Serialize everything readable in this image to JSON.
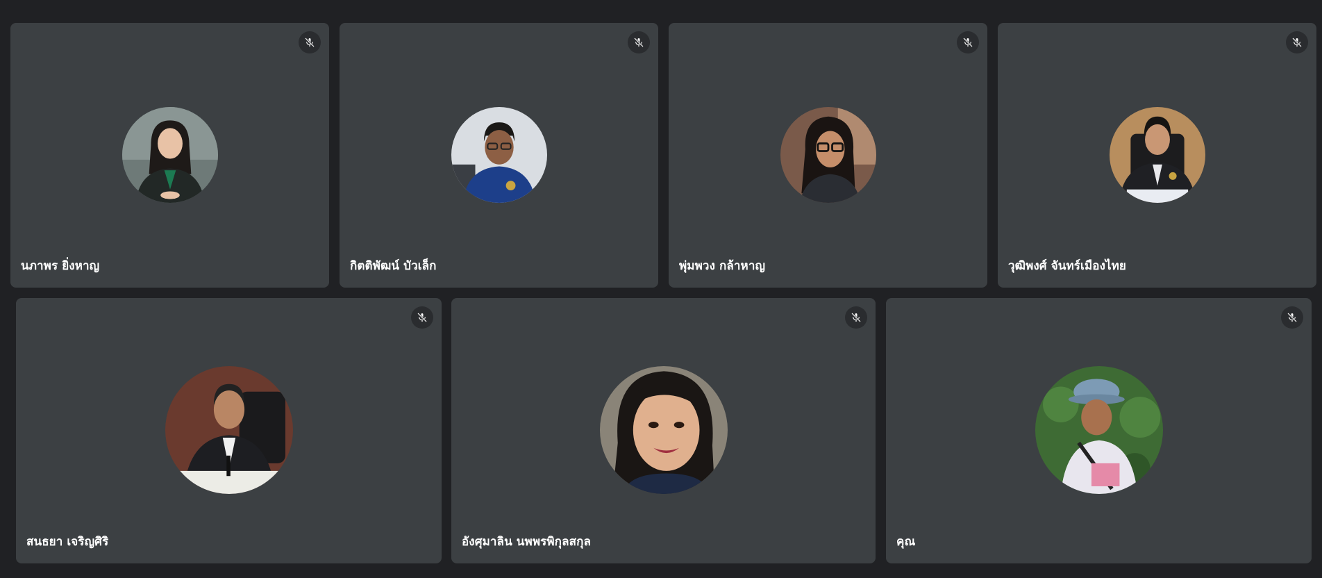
{
  "participants": [
    {
      "name": "นภาพร ยิ่งหาญ",
      "muted": true,
      "mic_icon": "mic-off-icon"
    },
    {
      "name": "กิตติพัฒน์ บัวเล็ก",
      "muted": true,
      "mic_icon": "mic-off-icon"
    },
    {
      "name": "พุ่มพวง กล้าหาญ",
      "muted": true,
      "mic_icon": "mic-off-icon"
    },
    {
      "name": "วุฒิพงศ์ จันทร์เมืองไทย",
      "muted": true,
      "mic_icon": "mic-off-icon"
    },
    {
      "name": "สนธยา เจริญศิริ",
      "muted": true,
      "mic_icon": "mic-off-icon"
    },
    {
      "name": "อังศุมาลิน นพพรพิกุลสกุล",
      "muted": true,
      "mic_icon": "mic-off-icon"
    },
    {
      "name": "คุณ",
      "muted": true,
      "mic_icon": "mic-off-icon"
    }
  ],
  "colors": {
    "background": "#202124",
    "tile": "#3c4043",
    "mic_button": "#2a2c2f",
    "text": "#ffffff"
  }
}
